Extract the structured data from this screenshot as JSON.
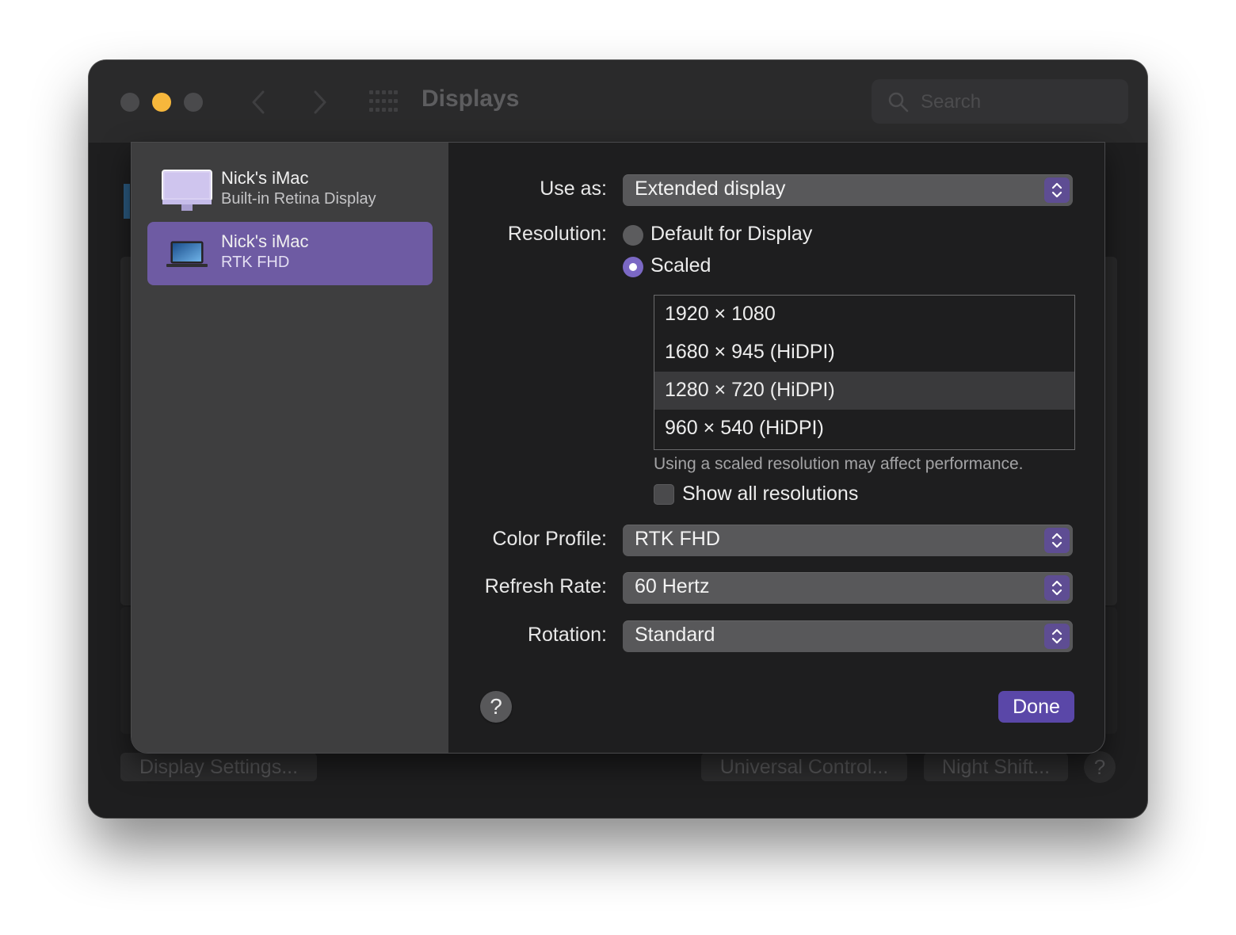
{
  "window": {
    "title": "Displays",
    "search_placeholder": "Search",
    "traffic_colors": [
      "#4a4a4c",
      "#f6b73c",
      "#4a4a4c"
    ]
  },
  "background_buttons": {
    "display_settings": "Display Settings...",
    "universal_control": "Universal Control...",
    "night_shift": "Night Shift...",
    "help": "?"
  },
  "sidebar": {
    "displays": [
      {
        "name": "Nick's iMac",
        "subtitle": "Built-in Retina Display",
        "icon": "imac-icon",
        "selected": false
      },
      {
        "name": "Nick's iMac",
        "subtitle": "RTK FHD",
        "icon": "laptop-display-icon",
        "selected": true
      }
    ]
  },
  "settings": {
    "use_as": {
      "label": "Use as:",
      "value": "Extended display"
    },
    "resolution": {
      "label": "Resolution:",
      "options": [
        {
          "label": "Default for Display",
          "selected": false
        },
        {
          "label": "Scaled",
          "selected": true
        }
      ],
      "list": [
        "1920 × 1080",
        "1680 × 945 (HiDPI)",
        "1280 × 720 (HiDPI)",
        "960 × 540 (HiDPI)"
      ],
      "selected_index": 2,
      "note": "Using a scaled resolution may affect performance.",
      "show_all_label": "Show all resolutions",
      "show_all_checked": false
    },
    "color_profile": {
      "label": "Color Profile:",
      "value": "RTK FHD"
    },
    "refresh_rate": {
      "label": "Refresh Rate:",
      "value": "60 Hertz"
    },
    "rotation": {
      "label": "Rotation:",
      "value": "Standard"
    }
  },
  "buttons": {
    "help": "?",
    "done": "Done"
  },
  "colors": {
    "accent": "#6e5ba3",
    "done": "#5a47a8",
    "radio_on": "#7b68c4"
  }
}
